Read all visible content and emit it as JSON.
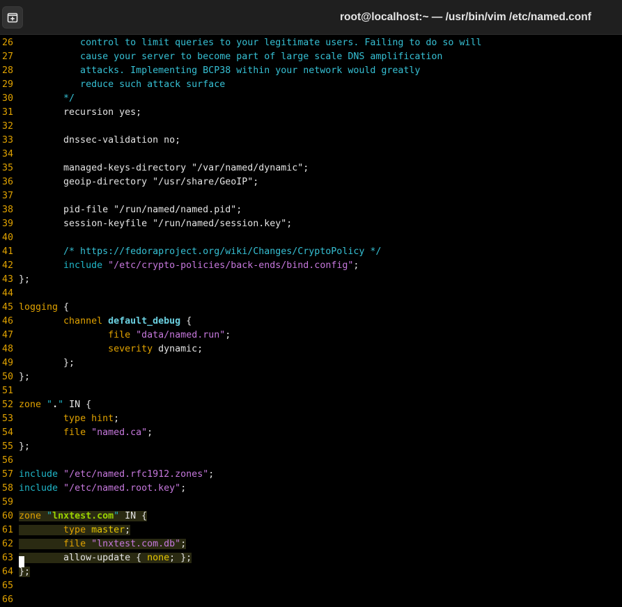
{
  "window": {
    "title": "root@localhost:~ — /usr/bin/vim /etc/named.conf",
    "new_tab_icon": "new-tab-icon"
  },
  "editor": {
    "lines": [
      {
        "n": "26",
        "t": "           control to limit queries to your legitimate users. Failing to do so will"
      },
      {
        "n": "27",
        "t": "           cause your server to become part of large scale DNS amplification"
      },
      {
        "n": "28",
        "t": "           attacks. Implementing BCP38 within your network would greatly"
      },
      {
        "n": "29",
        "t": "           reduce such attack surface"
      },
      {
        "n": "30",
        "t": "        */"
      },
      {
        "n": "31",
        "t": "        recursion yes;"
      },
      {
        "n": "32",
        "t": ""
      },
      {
        "n": "33",
        "t": "        dnssec-validation no;"
      },
      {
        "n": "34",
        "t": ""
      },
      {
        "n": "35",
        "t": "        managed-keys-directory \"/var/named/dynamic\";"
      },
      {
        "n": "36",
        "t": "        geoip-directory \"/usr/share/GeoIP\";"
      },
      {
        "n": "37",
        "t": ""
      },
      {
        "n": "38",
        "t": "        pid-file \"/run/named/named.pid\";"
      },
      {
        "n": "39",
        "t": "        session-keyfile \"/run/named/session.key\";"
      },
      {
        "n": "40",
        "t": ""
      },
      {
        "n": "41",
        "t": "        /* https://fedoraproject.org/wiki/Changes/CryptoPolicy */"
      },
      {
        "n": "42",
        "t": "        include \"/etc/crypto-policies/back-ends/bind.config\";"
      },
      {
        "n": "43",
        "t": "};"
      },
      {
        "n": "44",
        "t": ""
      },
      {
        "n": "45",
        "t": "logging {"
      },
      {
        "n": "46",
        "t": "        channel default_debug {"
      },
      {
        "n": "47",
        "t": "                file \"data/named.run\";"
      },
      {
        "n": "48",
        "t": "                severity dynamic;"
      },
      {
        "n": "49",
        "t": "        };"
      },
      {
        "n": "50",
        "t": "};"
      },
      {
        "n": "51",
        "t": ""
      },
      {
        "n": "52",
        "t": "zone \".\" IN {"
      },
      {
        "n": "53",
        "t": "        type hint;"
      },
      {
        "n": "54",
        "t": "        file \"named.ca\";"
      },
      {
        "n": "55",
        "t": "};"
      },
      {
        "n": "56",
        "t": ""
      },
      {
        "n": "57",
        "t": "include \"/etc/named.rfc1912.zones\";"
      },
      {
        "n": "58",
        "t": "include \"/etc/named.root.key\";"
      },
      {
        "n": "59",
        "t": ""
      },
      {
        "n": "60",
        "t": "zone \"lnxtest.com\" IN {"
      },
      {
        "n": "61",
        "t": "        type master;"
      },
      {
        "n": "62",
        "t": "        file \"lnxtest.com.db\";"
      },
      {
        "n": "63",
        "t": "        allow-update { none; };"
      },
      {
        "n": "64",
        "t": "};"
      },
      {
        "n": "65",
        "t": ""
      },
      {
        "n": "66",
        "t": ""
      }
    ]
  }
}
